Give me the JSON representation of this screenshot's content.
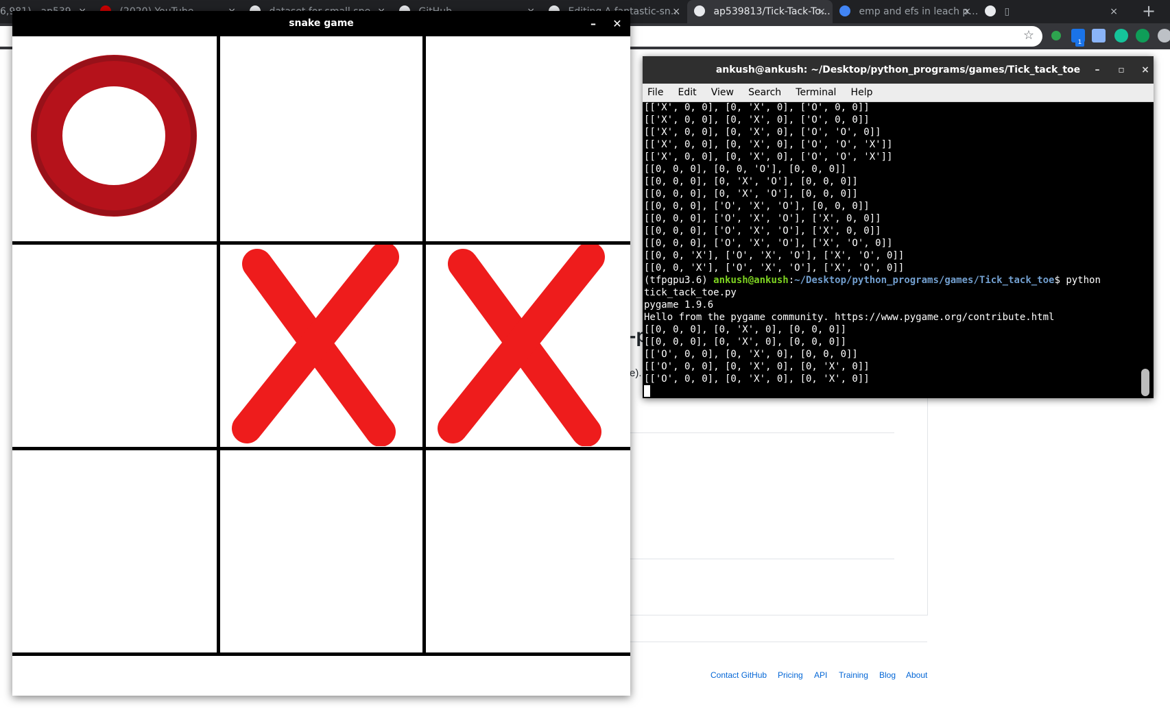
{
  "browser": {
    "tabs": [
      {
        "title": "6,981) - ap539…",
        "favicon_color": "#202124"
      },
      {
        "title": "(2020) YouTube",
        "favicon_color": "#cc0000"
      },
      {
        "title": "dataset for small spe…",
        "favicon_color": "#e8eaed"
      },
      {
        "title": "GitHub",
        "favicon_color": "#e8eaed"
      },
      {
        "title": "Editing A fantastic-sn…",
        "favicon_color": "#e8eaed"
      },
      {
        "title": "ap539813/Tick-Tack-To…",
        "favicon_color": "#e8eaed"
      },
      {
        "title": "emp and efs in leach p…",
        "favicon_color": "#4285f4"
      },
      {
        "title": "▯",
        "favicon_color": "#e8eaed"
      }
    ],
    "tab_close": "×",
    "new_tab": "+",
    "star": "☆",
    "ext_badge": "1"
  },
  "github_page": {
    "fragment_heading": "-p",
    "fragment_text": "e).",
    "footer_links": [
      "Contact GitHub",
      "Pricing",
      "API",
      "Training",
      "Blog",
      "About"
    ]
  },
  "terminal": {
    "title": "ankush@ankush: ~/Desktop/python_programs/games/Tick_tack_toe",
    "controls": {
      "minimize": "–",
      "maximize": "▫",
      "close": "×"
    },
    "menu": [
      "File",
      "Edit",
      "View",
      "Search",
      "Terminal",
      "Help"
    ],
    "lines_before": [
      "[['X', 0, 0], [0, 'X', 0], ['O', 0, 0]]",
      "[['X', 0, 0], [0, 'X', 0], ['O', 0, 0]]",
      "[['X', 0, 0], [0, 'X', 0], ['O', 'O', 0]]",
      "[['X', 0, 0], [0, 'X', 0], ['O', 'O', 'X']]",
      "[['X', 0, 0], [0, 'X', 0], ['O', 'O', 'X']]",
      "[[0, 0, 0], [0, 0, 'O'], [0, 0, 0]]",
      "[[0, 0, 0], [0, 'X', 'O'], [0, 0, 0]]",
      "[[0, 0, 0], [0, 'X', 'O'], [0, 0, 0]]",
      "[[0, 0, 0], ['O', 'X', 'O'], [0, 0, 0]]",
      "[[0, 0, 0], ['O', 'X', 'O'], ['X', 0, 0]]",
      "[[0, 0, 0], ['O', 'X', 'O'], ['X', 0, 0]]",
      "[[0, 0, 0], ['O', 'X', 'O'], ['X', 'O', 0]]",
      "[[0, 0, 'X'], ['O', 'X', 'O'], ['X', 'O', 0]]",
      "[[0, 0, 'X'], ['O', 'X', 'O'], ['X', 'O', 0]]"
    ],
    "prompt": {
      "env": "(tfpgpu3.6) ",
      "user": "ankush@ankush",
      "colon": ":",
      "path": "~/Desktop/python_programs/games/Tick_tack_toe",
      "symbol": "$ ",
      "command": "python"
    },
    "command_wrap": "tick_tack_toe.py",
    "lines_after": [
      "pygame 1.9.6",
      "Hello from the pygame community. https://www.pygame.org/contribute.html",
      "[[0, 0, 0], [0, 'X', 0], [0, 0, 0]]",
      "[[0, 0, 0], [0, 'X', 0], [0, 0, 0]]",
      "[['O', 0, 0], [0, 'X', 0], [0, 0, 0]]",
      "[['O', 0, 0], [0, 'X', 0], [0, 'X', 0]]",
      "[['O', 0, 0], [0, 'X', 0], [0, 'X', 0]]"
    ]
  },
  "game": {
    "title": "snake game",
    "controls": {
      "minimize": "–",
      "close": "✕"
    },
    "board": [
      [
        "O",
        "",
        ""
      ],
      [
        "",
        "X",
        "X"
      ],
      [
        "",
        "",
        ""
      ]
    ],
    "colors": {
      "o_mark": "#b5121b",
      "x_mark": "#ee1c1c",
      "grid": "#000000"
    }
  }
}
